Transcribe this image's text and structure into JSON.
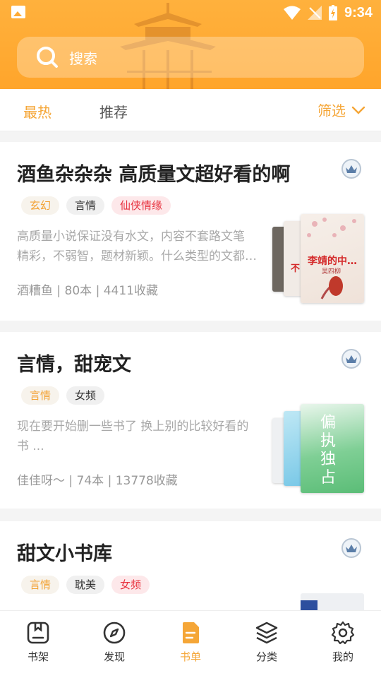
{
  "status": {
    "time": "9:34"
  },
  "search": {
    "placeholder": "搜索"
  },
  "tabs": [
    {
      "label": "最热"
    },
    {
      "label": "推荐"
    }
  ],
  "filter": {
    "label": "筛选"
  },
  "cards": [
    {
      "title": "酒鱼杂杂杂 高质量文超好看的啊",
      "tags": [
        {
          "label": "玄幻"
        },
        {
          "label": "言情"
        },
        {
          "label": "仙侠情缘"
        }
      ],
      "desc_lines": [
        "高质量小说保证没有水文，内容不套路文笔",
        "精彩，不弱智，题材新颖。什么类型的文都…"
      ],
      "meta": "酒糟鱼 | 80本 | 4411收藏",
      "cover_text": {
        "title": "李靖的中…",
        "author": "吴四柳",
        "left_char": "不"
      }
    },
    {
      "title": "言情，甜宠文",
      "tags": [
        {
          "label": "言情"
        },
        {
          "label": "女频"
        }
      ],
      "desc_lines": [
        "现在要开始删一些书了 换上别的比较好看的",
        "书 ..."
      ],
      "meta": "佳佳呀～ | 74本 | 13778收藏",
      "cover_text": {
        "title": "偏执独占"
      }
    },
    {
      "title": "甜文小书库",
      "tags": [
        {
          "label": "言情"
        },
        {
          "label": "耽美"
        },
        {
          "label": "女频"
        }
      ]
    }
  ],
  "nav": [
    {
      "label": "书架"
    },
    {
      "label": "发现"
    },
    {
      "label": "书单"
    },
    {
      "label": "分类"
    },
    {
      "label": "我的"
    }
  ],
  "colors": {
    "accent": "#f5a637",
    "header": "#ffab35",
    "tag_red": "#e8323f"
  }
}
